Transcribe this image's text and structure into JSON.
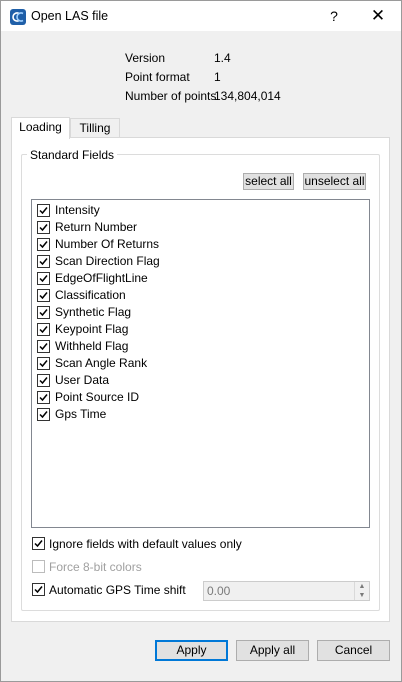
{
  "window": {
    "title": "Open LAS file",
    "help_glyph": "?",
    "close_glyph": "✕",
    "app_icon": "cloudcompare-icon"
  },
  "info": {
    "version_label": "Version",
    "version_value": "1.4",
    "format_label": "Point format",
    "format_value": "1",
    "count_label": "Number of points",
    "count_value": "134,804,014"
  },
  "tabs": [
    {
      "label": "Loading",
      "active": true
    },
    {
      "label": "Tilling",
      "active": false
    }
  ],
  "group": {
    "title": "Standard Fields",
    "select_all": "select all",
    "unselect_all": "unselect all"
  },
  "fields": [
    {
      "label": "Intensity",
      "checked": true
    },
    {
      "label": "Return Number",
      "checked": true
    },
    {
      "label": "Number Of Returns",
      "checked": true
    },
    {
      "label": "Scan Direction Flag",
      "checked": true
    },
    {
      "label": "EdgeOfFlightLine",
      "checked": true
    },
    {
      "label": "Classification",
      "checked": true
    },
    {
      "label": "Synthetic Flag",
      "checked": true
    },
    {
      "label": "Keypoint Flag",
      "checked": true
    },
    {
      "label": "Withheld Flag",
      "checked": true
    },
    {
      "label": "Scan Angle Rank",
      "checked": true
    },
    {
      "label": "User Data",
      "checked": true
    },
    {
      "label": "Point Source ID",
      "checked": true
    },
    {
      "label": "Gps Time",
      "checked": true
    }
  ],
  "options": {
    "ignore_default": {
      "label": "Ignore fields with default values only",
      "checked": true
    },
    "force_8bit": {
      "label": "Force 8-bit colors",
      "checked": false,
      "enabled": false
    },
    "gps_shift": {
      "label": "Automatic GPS Time shift",
      "checked": true,
      "value": "0.00"
    }
  },
  "buttons": {
    "apply": "Apply",
    "apply_all": "Apply all",
    "cancel": "Cancel"
  }
}
